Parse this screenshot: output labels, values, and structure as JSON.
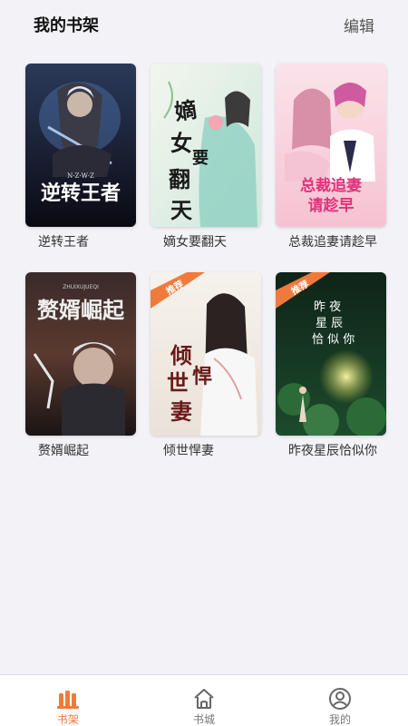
{
  "header": {
    "title": "我的书架",
    "edit_label": "编辑"
  },
  "books": [
    {
      "title": "逆转王者",
      "cover_text": "逆转王者",
      "cover_sub": "N·Z·W·Z",
      "badge": ""
    },
    {
      "title": "嫡女要翻天",
      "cover_text": "嫡女要翻天",
      "badge": ""
    },
    {
      "title": "总裁追妻请趁早",
      "cover_text": "总裁追妻请趁早",
      "badge": ""
    },
    {
      "title": "赘婿崛起",
      "cover_text": "赘婿崛起",
      "cover_sub": "ZHUIXUJUEQI",
      "badge": ""
    },
    {
      "title": "倾世悍妻",
      "cover_text": "倾世悍妻",
      "badge": "推荐"
    },
    {
      "title": "昨夜星辰恰似你",
      "cover_text": "昨夜星辰恰似你",
      "badge": "推荐"
    }
  ],
  "tabs": [
    {
      "label": "书架",
      "icon": "bookshelf-icon",
      "active": true
    },
    {
      "label": "书城",
      "icon": "home-icon",
      "active": false
    },
    {
      "label": "我的",
      "icon": "user-icon",
      "active": false
    }
  ],
  "colors": {
    "accent": "#f07a3c",
    "background": "#f2f2f7"
  }
}
